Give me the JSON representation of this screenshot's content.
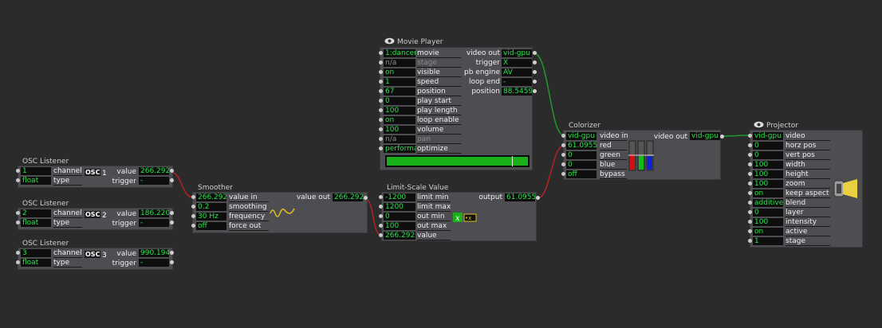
{
  "osc1": {
    "title": "OSC Listener",
    "channel_val": "1",
    "channel_lbl": "channel",
    "type_val": "float",
    "type_lbl": "type",
    "osc": "OSC",
    "num": "1",
    "value_lbl": "value",
    "value_val": "266.292",
    "trigger_lbl": "trigger",
    "trigger_val": "-"
  },
  "osc2": {
    "title": "OSC Listener",
    "channel_val": "2",
    "channel_lbl": "channel",
    "type_val": "float",
    "type_lbl": "type",
    "osc": "OSC",
    "num": "2",
    "value_lbl": "value",
    "value_val": "186.220",
    "trigger_lbl": "trigger",
    "trigger_val": "-"
  },
  "osc3": {
    "title": "OSC Listener",
    "channel_val": "3",
    "channel_lbl": "channel",
    "type_val": "float",
    "type_lbl": "type",
    "osc": "OSC",
    "num": "3",
    "value_lbl": "value",
    "value_val": "990.194",
    "trigger_lbl": "trigger",
    "trigger_val": "-"
  },
  "smoother": {
    "title": "Smoother",
    "inputs": [
      [
        "266.292",
        "value in"
      ],
      [
        "0.2",
        "smoothing"
      ],
      [
        "30 Hz",
        "frequency"
      ],
      [
        "off",
        "force out"
      ]
    ],
    "out_lbl": "value out",
    "out_val": "266.292"
  },
  "movie": {
    "title": "Movie Player",
    "inputs": [
      [
        "1:dancer",
        "movie"
      ],
      [
        "n/a",
        "stage"
      ],
      [
        "on",
        "visible"
      ],
      [
        "1",
        "speed"
      ],
      [
        "67",
        "position"
      ],
      [
        "0",
        "play start"
      ],
      [
        "100",
        "play length"
      ],
      [
        "on",
        "loop enable"
      ],
      [
        "100",
        "volume"
      ],
      [
        "n/a",
        "pan"
      ],
      [
        "performa",
        "optimize"
      ]
    ],
    "outputs": [
      [
        "video out",
        "vid-gpu"
      ],
      [
        "trigger",
        "X"
      ],
      [
        "pb engine",
        "AV"
      ],
      [
        "loop end",
        "-"
      ],
      [
        "position",
        "88.5459"
      ]
    ],
    "accent": "#1fb01f"
  },
  "limit": {
    "title": "Limit-Scale Value",
    "inputs": [
      [
        "-1200",
        "limit min"
      ],
      [
        "1200",
        "limit max"
      ],
      [
        "0",
        "out min"
      ],
      [
        "100",
        "out max"
      ],
      [
        "266.292",
        "value"
      ]
    ],
    "out_lbl": "output",
    "out_val": "61.0955"
  },
  "colorizer": {
    "title": "Colorizer",
    "inputs": [
      [
        "vid-gpu",
        "video in"
      ],
      [
        "61.0955",
        "red"
      ],
      [
        "0",
        "green"
      ],
      [
        "0",
        "blue"
      ],
      [
        "off",
        "bypass"
      ]
    ],
    "out_lbl": "video out",
    "out_val": "vid-gpu"
  },
  "projector": {
    "title": "Projector",
    "inputs": [
      [
        "vid-gpu",
        "video"
      ],
      [
        "0",
        "horz pos"
      ],
      [
        "0",
        "vert pos"
      ],
      [
        "100",
        "width"
      ],
      [
        "100",
        "height"
      ],
      [
        "100",
        "zoom"
      ],
      [
        "on",
        "keep aspect"
      ],
      [
        "additive",
        "blend"
      ],
      [
        "0",
        "layer"
      ],
      [
        "100",
        "intensity"
      ],
      [
        "on",
        "active"
      ],
      [
        "1",
        "stage"
      ]
    ]
  },
  "colors": {
    "background": "#2b2b2b",
    "actor": "#4d4d52",
    "value_text": "#29e34b",
    "wire_red": "#b02020",
    "wire_green": "#1f9a2f"
  }
}
